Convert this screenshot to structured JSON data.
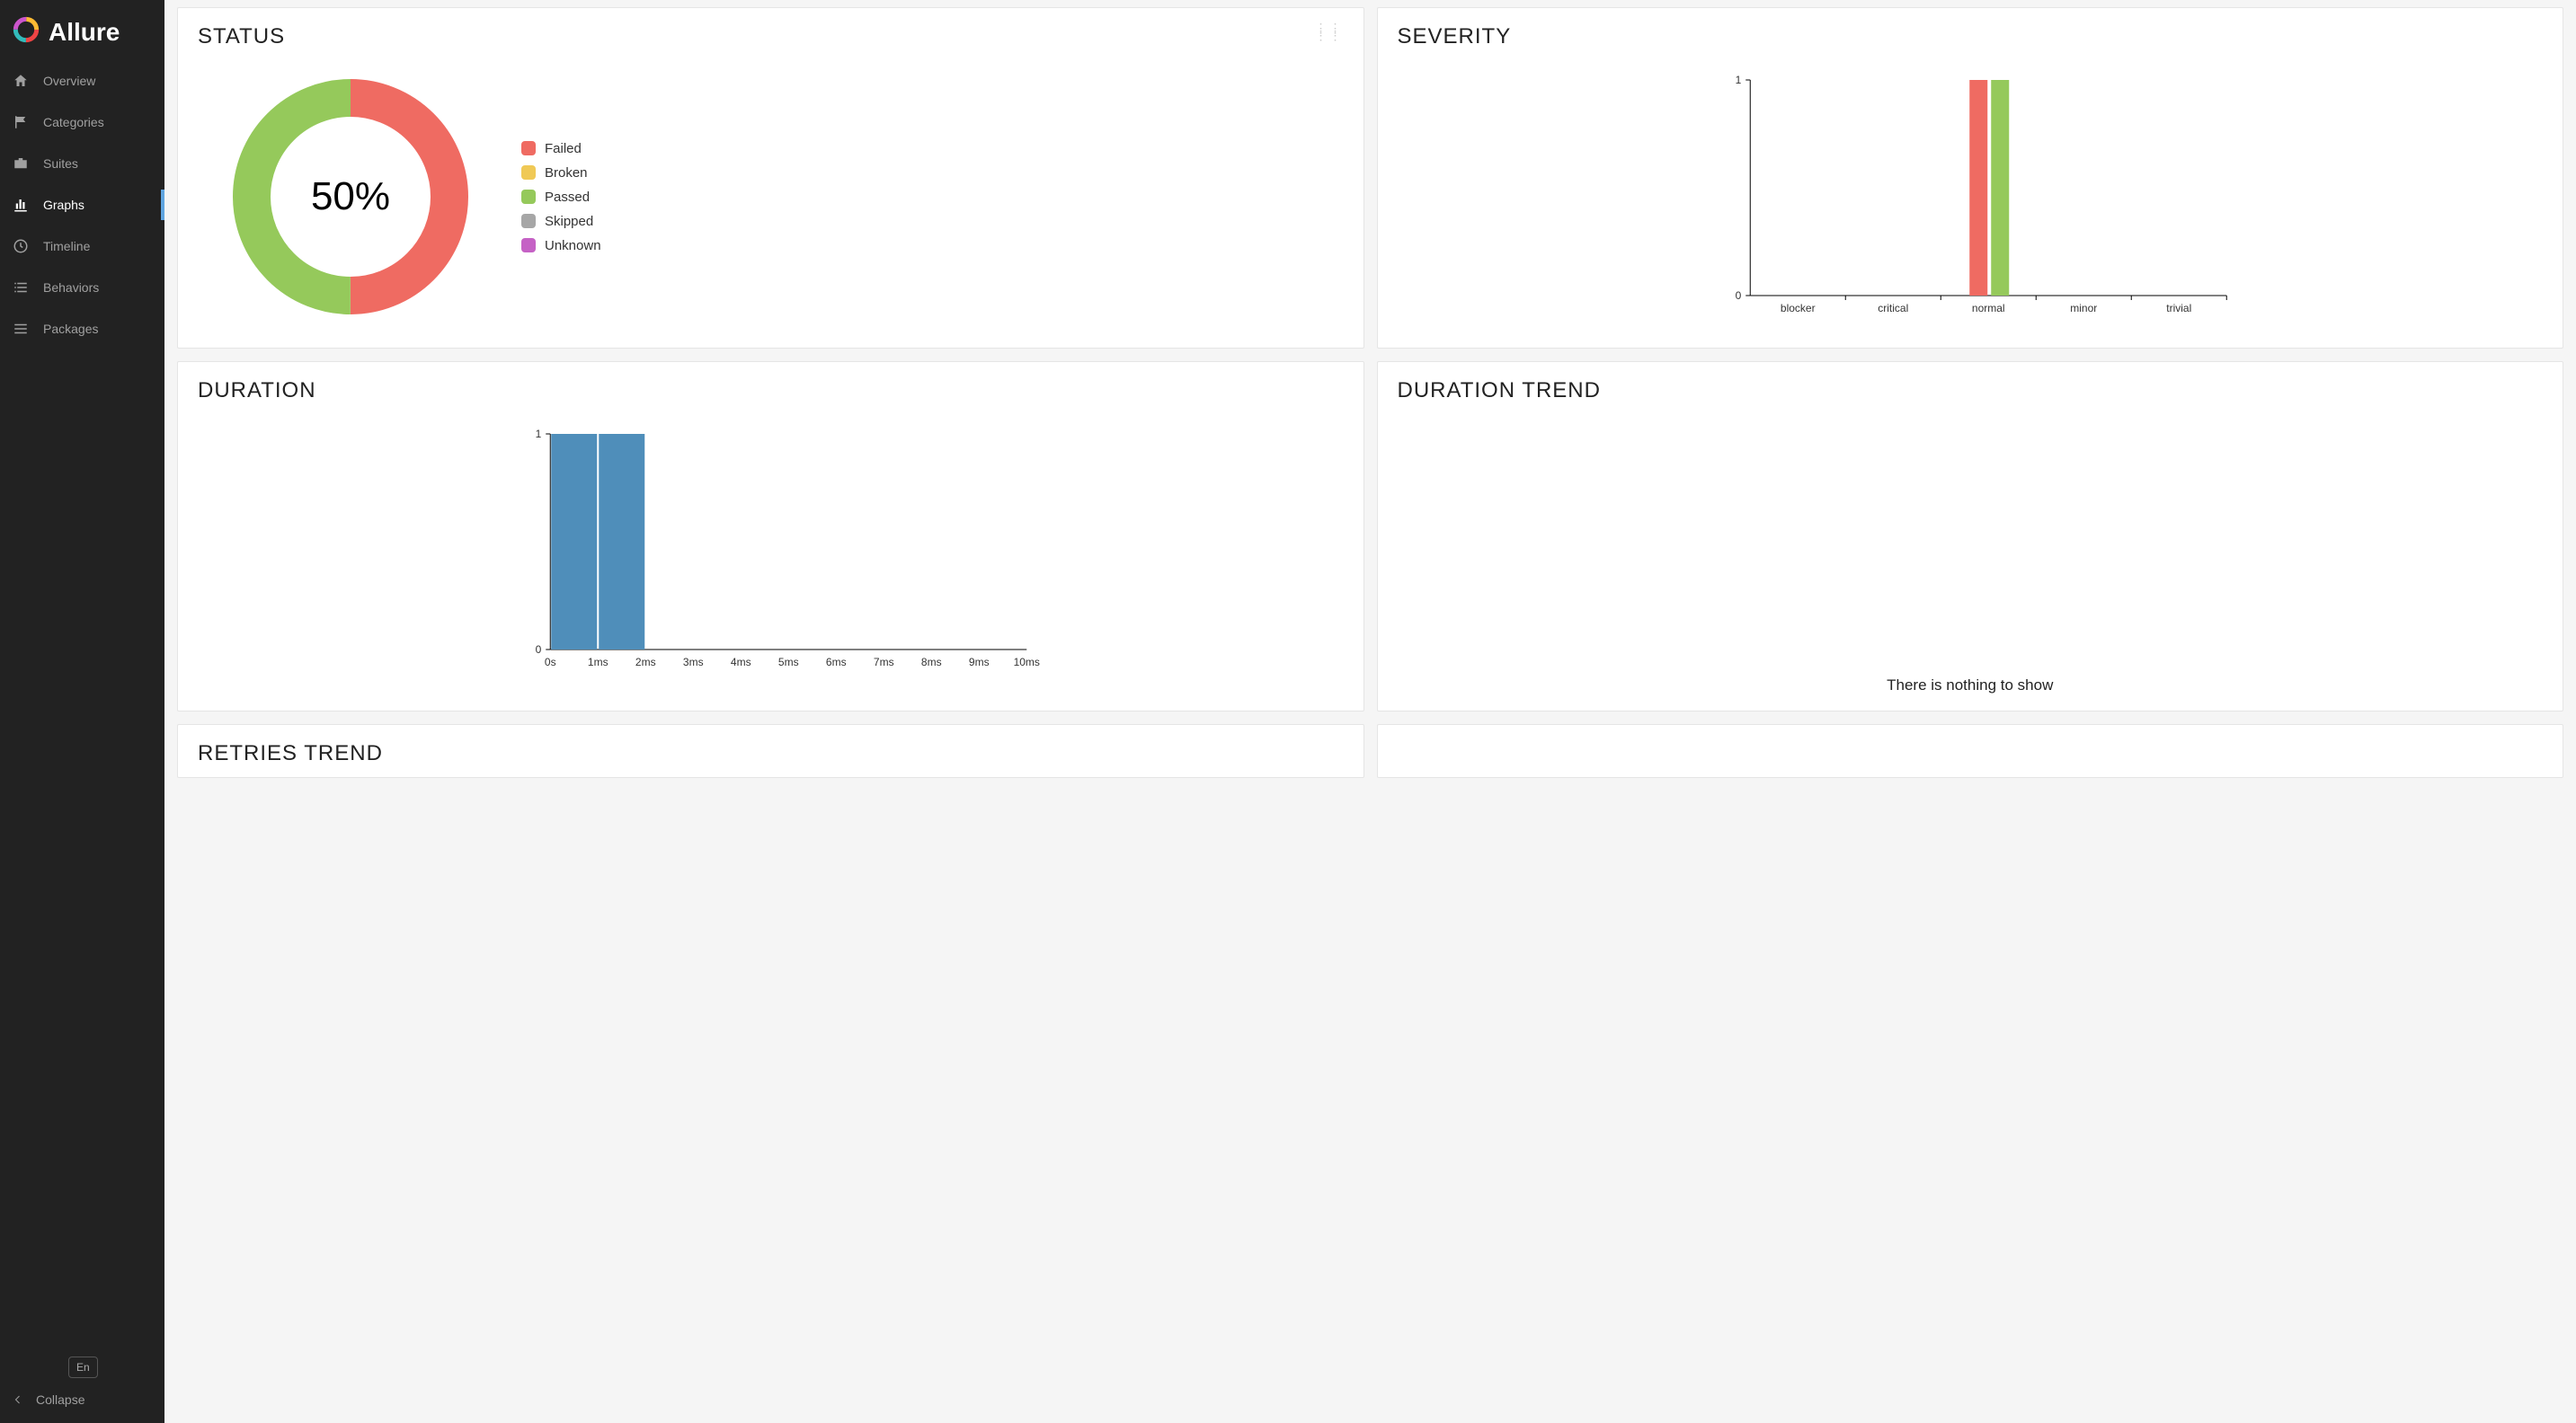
{
  "app": {
    "name": "Allure"
  },
  "sidebar": {
    "items": [
      {
        "label": "Overview"
      },
      {
        "label": "Categories"
      },
      {
        "label": "Suites"
      },
      {
        "label": "Graphs"
      },
      {
        "label": "Timeline"
      },
      {
        "label": "Behaviors"
      },
      {
        "label": "Packages"
      }
    ],
    "lang": "En",
    "collapse": "Collapse"
  },
  "cards": {
    "status": {
      "title": "STATUS",
      "centerLabel": "50%"
    },
    "severity": {
      "title": "SEVERITY"
    },
    "duration": {
      "title": "DURATION"
    },
    "durationTrend": {
      "title": "DURATION TREND",
      "empty": "There is nothing to show"
    },
    "retriesTrend": {
      "title": "RETRIES TREND"
    }
  },
  "colors": {
    "failed": "#ef6b62",
    "broken": "#f0c956",
    "passed": "#95C95B",
    "skipped": "#a6a6a6",
    "unknown": "#c561c5",
    "barBlue": "#4f8eba"
  },
  "chart_data": [
    {
      "type": "pie",
      "title": "STATUS",
      "series": [
        {
          "name": "Failed",
          "value": 50,
          "color": "#ef6b62"
        },
        {
          "name": "Broken",
          "value": 0,
          "color": "#f0c956"
        },
        {
          "name": "Passed",
          "value": 50,
          "color": "#95C95B"
        },
        {
          "name": "Skipped",
          "value": 0,
          "color": "#a6a6a6"
        },
        {
          "name": "Unknown",
          "value": 0,
          "color": "#c561c5"
        }
      ],
      "centerLabel": "50%"
    },
    {
      "type": "bar",
      "title": "SEVERITY",
      "categories": [
        "blocker",
        "critical",
        "normal",
        "minor",
        "trivial"
      ],
      "series": [
        {
          "name": "Failed",
          "values": [
            0,
            0,
            1,
            0,
            0
          ],
          "color": "#ef6b62"
        },
        {
          "name": "Passed",
          "values": [
            0,
            0,
            1,
            0,
            0
          ],
          "color": "#95C95B"
        }
      ],
      "ylabel": "",
      "ylim": [
        0,
        1
      ],
      "yTicks": [
        0,
        1
      ]
    },
    {
      "type": "bar",
      "title": "DURATION",
      "categories": [
        "0s",
        "1ms",
        "2ms",
        "3ms",
        "4ms",
        "5ms",
        "6ms",
        "7ms",
        "8ms",
        "9ms",
        "10ms"
      ],
      "values": [
        1,
        1,
        0,
        0,
        0,
        0,
        0,
        0,
        0,
        0
      ],
      "ylabel": "",
      "ylim": [
        0,
        1
      ],
      "yTicks": [
        0,
        1
      ],
      "barColor": "#4f8eba",
      "note": "Histogram: two bars of height 1 in bins 0s–1ms and 1ms–2ms"
    },
    {
      "type": "line",
      "title": "DURATION TREND",
      "series": [],
      "empty": true,
      "emptyText": "There is nothing to show"
    },
    {
      "type": "line",
      "title": "RETRIES TREND",
      "series": []
    }
  ],
  "legend": {
    "items": [
      {
        "label": "Failed",
        "color": "#ef6b62"
      },
      {
        "label": "Broken",
        "color": "#f0c956"
      },
      {
        "label": "Passed",
        "color": "#95C95B"
      },
      {
        "label": "Skipped",
        "color": "#a6a6a6"
      },
      {
        "label": "Unknown",
        "color": "#c561c5"
      }
    ]
  }
}
